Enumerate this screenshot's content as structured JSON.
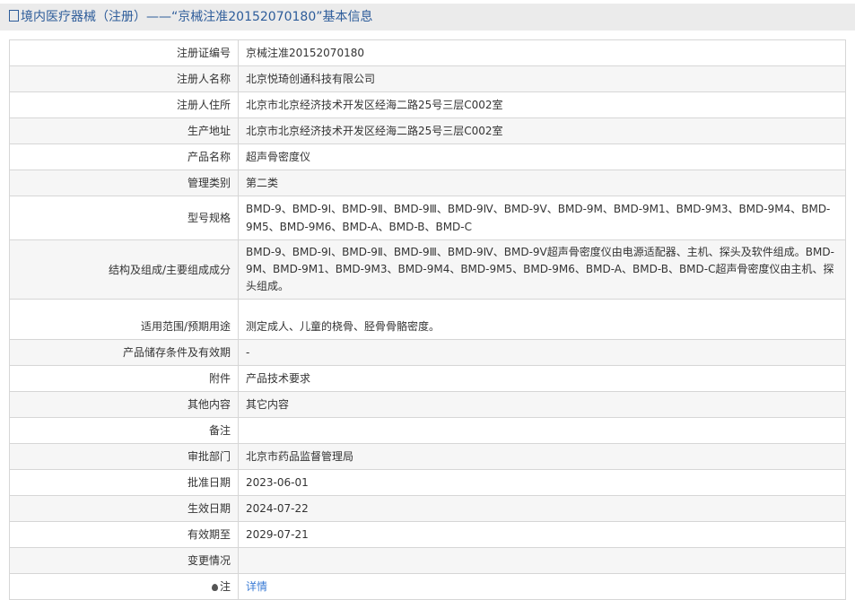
{
  "header": {
    "title": "境内医疗器械（注册）——“京械注准20152070180”基本信息"
  },
  "rows": [
    {
      "label": "注册证编号",
      "value": "京械注准20152070180"
    },
    {
      "label": "注册人名称",
      "value": "北京悦琦创通科技有限公司"
    },
    {
      "label": "注册人住所",
      "value": "北京市北京经济技术开发区经海二路25号三层C002室"
    },
    {
      "label": "生产地址",
      "value": "北京市北京经济技术开发区经海二路25号三层C002室"
    },
    {
      "label": "产品名称",
      "value": "超声骨密度仪"
    },
    {
      "label": "管理类别",
      "value": "第二类"
    },
    {
      "label": "型号规格",
      "value": "BMD-9、BMD-9Ⅰ、BMD-9Ⅱ、BMD-9Ⅲ、BMD-9Ⅳ、BMD-9Ⅴ、BMD-9M、BMD-9M1、BMD-9M3、BMD-9M4、BMD-9M5、BMD-9M6、BMD-A、BMD-B、BMD-C"
    },
    {
      "label": "结构及组成/主要组成成分",
      "value": "BMD-9、BMD-9Ⅰ、BMD-9Ⅱ、BMD-9Ⅲ、BMD-9Ⅳ、BMD-9Ⅴ超声骨密度仪由电源适配器、主机、探头及软件组成。BMD-9M、BMD-9M1、BMD-9M3、BMD-9M4、BMD-9M5、BMD-9M6、BMD-A、BMD-B、BMD-C超声骨密度仪由主机、探头组成。"
    },
    {
      "label": "适用范围/预期用途",
      "value": "测定成人、儿童的桡骨、胫骨骨骼密度。"
    },
    {
      "label": "产品储存条件及有效期",
      "value": "-"
    },
    {
      "label": "附件",
      "value": "产品技术要求"
    },
    {
      "label": "其他内容",
      "value": "其它内容"
    },
    {
      "label": "备注",
      "value": ""
    },
    {
      "label": "审批部门",
      "value": "北京市药品监督管理局"
    },
    {
      "label": "批准日期",
      "value": "2023-06-01"
    },
    {
      "label": "生效日期",
      "value": "2024-07-22"
    },
    {
      "label": "有效期至",
      "value": "2029-07-21"
    },
    {
      "label": "变更情况",
      "value": ""
    }
  ],
  "note": {
    "label": "注",
    "link": "详情"
  }
}
